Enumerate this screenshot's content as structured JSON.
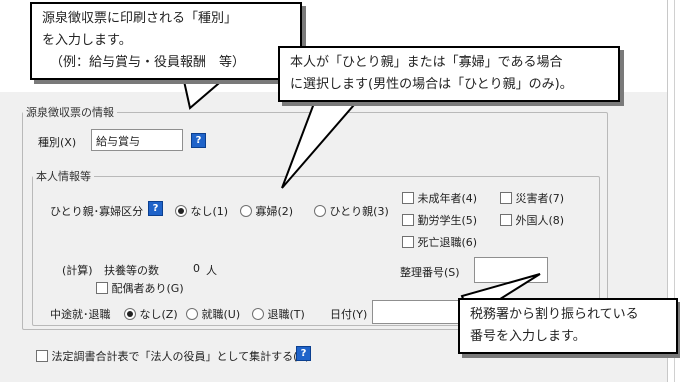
{
  "callouts": {
    "top_left": {
      "line1": "源泉徴収票に印刷される「種別」",
      "line2": "を入力します。",
      "line3": "（例：給与賞与・役員報酬　等）"
    },
    "top_right": {
      "line1": "本人が「ひとり親」または「寡婦」である場合",
      "line2": "に選択します(男性の場合は「ひとり親」のみ)。"
    },
    "bottom_right": {
      "line1": "税務署から割り振られている",
      "line2": "番号を入力します。"
    }
  },
  "section": {
    "title": "源泉徴収票の情報",
    "type_label": "種別(X)",
    "type_value": "給与賞与"
  },
  "person": {
    "title": "本人情報等",
    "single_parent_label": "ひとり親･寡婦区分",
    "radio_none": "なし(1)",
    "radio_widow": "寡婦(2)",
    "radio_single_parent": "ひとり親(3)",
    "minor": "未成年者(4)",
    "disabled": "災害者(7)",
    "working_student": "勤労学生(5)",
    "foreigner": "外国人(8)",
    "deceased": "死亡退職(6)",
    "calc_label": "(計算)",
    "dependents_label": "扶養等の数",
    "dependents_count": "0",
    "dependents_unit": "人",
    "spouse_label": "配偶者あり(G)",
    "serial_label": "整理番号(S)",
    "serial_value": "",
    "midyear_label": "中途就･退職",
    "midyear_none": "なし(Z)",
    "midyear_join": "就職(U)",
    "midyear_leave": "退職(T)",
    "date_label": "日付(Y)",
    "date_value": ""
  },
  "footer": {
    "statutory_label": "法定調書合計表で「法人の役員」として集計する(R)"
  },
  "colors": {
    "help_icon": "#1f63c9",
    "dialog_bg": "#f0f0f0"
  }
}
